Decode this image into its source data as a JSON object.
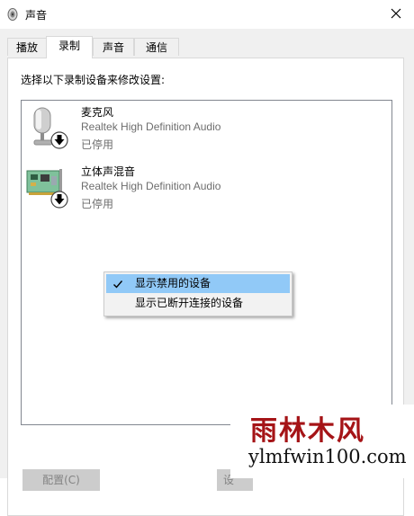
{
  "window": {
    "title": "声音"
  },
  "tabs": [
    {
      "label": "播放",
      "active": false
    },
    {
      "label": "录制",
      "active": true
    },
    {
      "label": "声音",
      "active": false
    },
    {
      "label": "通信",
      "active": false
    }
  ],
  "panel": {
    "instruction": "选择以下录制设备来修改设置:"
  },
  "devices": [
    {
      "name": "麦克风",
      "driver": "Realtek High Definition Audio",
      "status": "已停用",
      "icon": "microphone-icon"
    },
    {
      "name": "立体声混音",
      "driver": "Realtek High Definition Audio",
      "status": "已停用",
      "icon": "sound-card-icon"
    }
  ],
  "context_menu": {
    "items": [
      {
        "label": "显示禁用的设备",
        "checked": true
      },
      {
        "label": "显示已断开连接的设备",
        "checked": false
      }
    ]
  },
  "buttons": {
    "configure": "配置(C)",
    "set_default_partial": "设"
  },
  "watermark": {
    "chinese": "雨林木风",
    "url": "ylmfwin100.com"
  },
  "colors": {
    "menu_highlight": "#91c9f7",
    "watermark_red": "#a51417"
  }
}
